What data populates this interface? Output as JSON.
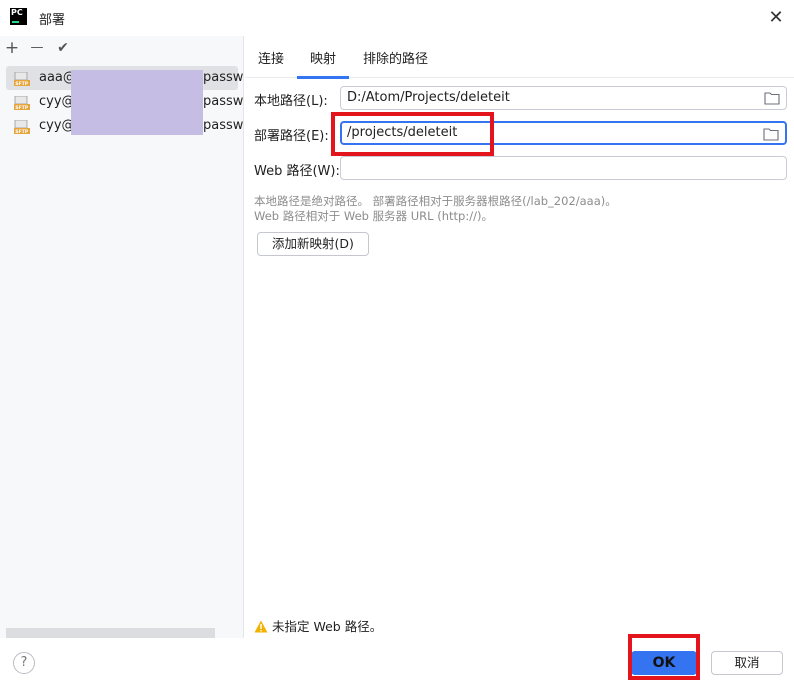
{
  "window": {
    "title": "部署",
    "app_icon": "PC",
    "close": "✕"
  },
  "left_toolbar": {
    "add": "+",
    "remove": "—",
    "check": "✔"
  },
  "servers": [
    {
      "name": "aaa@",
      "pass": "passwo"
    },
    {
      "name": "cyy@",
      "pass": "passwo"
    },
    {
      "name": "cyy@",
      "pass": "passwo"
    }
  ],
  "tabs": [
    {
      "label": "连接"
    },
    {
      "label": "映射"
    },
    {
      "label": "排除的路径"
    }
  ],
  "mapping": {
    "local_label": "本地路径(L):",
    "local_value": "D:/Atom/Projects/deleteit",
    "deploy_label": "部署路径(E):",
    "deploy_value": "/projects/deleteit",
    "web_label": "Web 路径(W):",
    "web_value": "",
    "hint_line1": "本地路径是绝对路径。 部署路径相对于服务器根路径(/lab_202/aaa)。",
    "hint_line2": "Web 路径相对于 Web 服务器 URL (http://)。",
    "add_button": "添加新映射(D)",
    "warning": "未指定 Web 路径。"
  },
  "footer": {
    "help": "?",
    "ok": "OK",
    "cancel": "取消"
  },
  "colors": {
    "accent": "#3574f0",
    "annotation": "#e3141b",
    "redaction": "#c5bde3",
    "warning": "#f2b200"
  }
}
